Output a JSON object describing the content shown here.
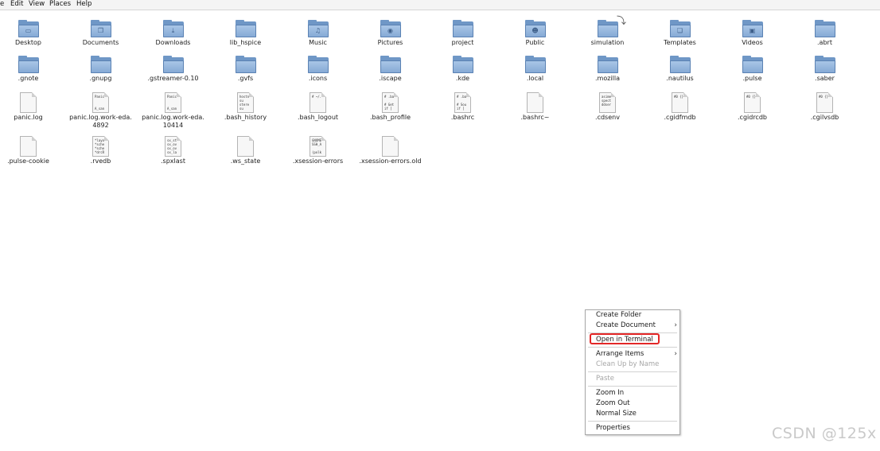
{
  "menubar": {
    "items": [
      "e",
      "Edit",
      "View",
      "Places",
      "Help"
    ]
  },
  "icons": [
    {
      "label": "Desktop",
      "kind": "folder",
      "emblem": "desktop"
    },
    {
      "label": "Documents",
      "kind": "folder",
      "emblem": "documents"
    },
    {
      "label": "Downloads",
      "kind": "folder",
      "emblem": "download"
    },
    {
      "label": "lib_hspice",
      "kind": "folder",
      "emblem": ""
    },
    {
      "label": "Music",
      "kind": "folder",
      "emblem": "music"
    },
    {
      "label": "Pictures",
      "kind": "folder",
      "emblem": "camera"
    },
    {
      "label": "project",
      "kind": "folder",
      "emblem": ""
    },
    {
      "label": "Public",
      "kind": "folder",
      "emblem": "person"
    },
    {
      "label": "simulation",
      "kind": "folder",
      "emblem": ""
    },
    {
      "label": "Templates",
      "kind": "folder",
      "emblem": "templates"
    },
    {
      "label": "Videos",
      "kind": "folder",
      "emblem": "film"
    },
    {
      "label": ".abrt",
      "kind": "folder",
      "emblem": ""
    },
    {
      "label": ".gnote",
      "kind": "folder",
      "emblem": ""
    },
    {
      "label": ".gnupg",
      "kind": "folder",
      "emblem": ""
    },
    {
      "label": ".gstreamer-0.10",
      "kind": "folder",
      "emblem": ""
    },
    {
      "label": ".gvfs",
      "kind": "folder",
      "emblem": ""
    },
    {
      "label": ".icons",
      "kind": "folder",
      "emblem": ""
    },
    {
      "label": ".iscape",
      "kind": "folder",
      "emblem": ""
    },
    {
      "label": ".kde",
      "kind": "folder",
      "emblem": ""
    },
    {
      "label": ".local",
      "kind": "folder",
      "emblem": ""
    },
    {
      "label": ".mozilla",
      "kind": "folder",
      "emblem": ""
    },
    {
      "label": ".nautilus",
      "kind": "folder",
      "emblem": ""
    },
    {
      "label": ".pulse",
      "kind": "folder",
      "emblem": ""
    },
    {
      "label": ".saber",
      "kind": "folder",
      "emblem": ""
    },
    {
      "label": "panic.log",
      "kind": "doc",
      "preview": ""
    },
    {
      "label": "panic.log.work-eda.\n4892",
      "kind": "doc",
      "preview": "Panic-\n\n\nA_san"
    },
    {
      "label": "panic.log.work-eda.\n10414",
      "kind": "doc",
      "preview": "Panic\n\n\nA_san"
    },
    {
      "label": ".bash_history",
      "kind": "doc",
      "preview": "hostn\nsu\nstere\nsu"
    },
    {
      "label": ".bash_logout",
      "kind": "doc",
      "preview": "# ~/."
    },
    {
      "label": ".bash_profile",
      "kind": "doc",
      "preview": "# .ba\n\n# Get\nif ["
    },
    {
      "label": ".bashrc",
      "kind": "doc",
      "preview": "# .ba\n\n# Sou\nif ["
    },
    {
      "label": ".bashrc~",
      "kind": "doc",
      "preview": ""
    },
    {
      "label": ".cdsenv",
      "kind": "doc",
      "preview": "asime\nspect\nddser"
    },
    {
      "label": ".cgidfmdb",
      "kind": "doc",
      "preview": "#0 {}"
    },
    {
      "label": ".cgidrcdb",
      "kind": "doc",
      "preview": "#0 {}"
    },
    {
      "label": ".cgilvsdb",
      "kind": "doc",
      "preview": "#0 {}"
    },
    {
      "label": ".pulse-cookie",
      "kind": "doc",
      "preview": ""
    },
    {
      "label": ".rvedb",
      "kind": "doc",
      "preview": "*layo\n*sche\n*sche\n*drcR"
    },
    {
      "label": ".spxlast",
      "kind": "doc",
      "preview": "sx_st\nsx_ov\nsx_ov\nsx_la"
    },
    {
      "label": ".ws_state",
      "kind": "doc",
      "preview": ""
    },
    {
      "label": ".xsession-errors",
      "kind": "doc",
      "preview": "GNOME\nSSH_A\n\n(polk"
    },
    {
      "label": ".xsession-errors.old",
      "kind": "doc",
      "preview": ""
    }
  ],
  "context_menu": {
    "items": [
      {
        "label": "Create Folder",
        "submenu": false,
        "disabled": false
      },
      {
        "label": "Create Document",
        "submenu": true,
        "disabled": false
      },
      {
        "label": "Open in Terminal",
        "submenu": false,
        "disabled": false,
        "highlighted": true
      },
      {
        "label": "Arrange Items",
        "submenu": true,
        "disabled": false
      },
      {
        "label": "Clean Up by Name",
        "submenu": false,
        "disabled": true
      },
      {
        "label": "Paste",
        "submenu": false,
        "disabled": true
      },
      {
        "label": "Zoom In",
        "submenu": false,
        "disabled": false
      },
      {
        "label": "Zoom Out",
        "submenu": false,
        "disabled": false
      },
      {
        "label": "Normal Size",
        "submenu": false,
        "disabled": false
      },
      {
        "label": "Properties",
        "submenu": false,
        "disabled": false
      }
    ],
    "highlight_color": "#e32727"
  },
  "watermark": "CSDN @125x",
  "colors": {
    "folder": "#86aad5",
    "folder_dark": "#6f97c6"
  }
}
